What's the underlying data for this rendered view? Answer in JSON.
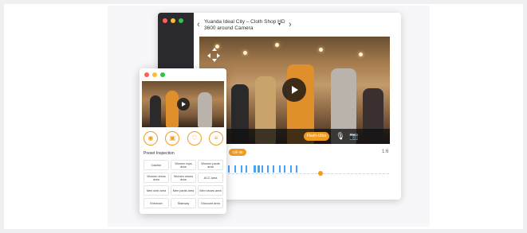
{
  "main_window": {
    "title": "Yuanda Ideal City – Cloth Shop HD 3600 around Camera",
    "title_caret": "▾",
    "back_icon": "chevron-left-icon",
    "forward_icon": "chevron-right-icon",
    "controls": {
      "rewind_label": "10",
      "quality_label": "Flash-Ultra"
    },
    "date_badge": "Gili-35",
    "zoom_label": "1:6"
  },
  "colors": {
    "accent": "#f29b21",
    "sidebar": "#2b2b2f",
    "timeline": "#4aa2f0"
  },
  "popup": {
    "section_title": "Preset Inspection",
    "quick_icons": [
      "camera-icon",
      "video-icon",
      "heart-icon",
      "menu-icon"
    ],
    "presets": [
      "Cashier",
      "Women tops area",
      "Women pants area",
      "Women dress area",
      "Women shoes area",
      "ACC area",
      "Men shirt area",
      "Men pants area",
      "Men shoes area",
      "Entrance",
      "Stairway",
      "Discount area"
    ]
  }
}
